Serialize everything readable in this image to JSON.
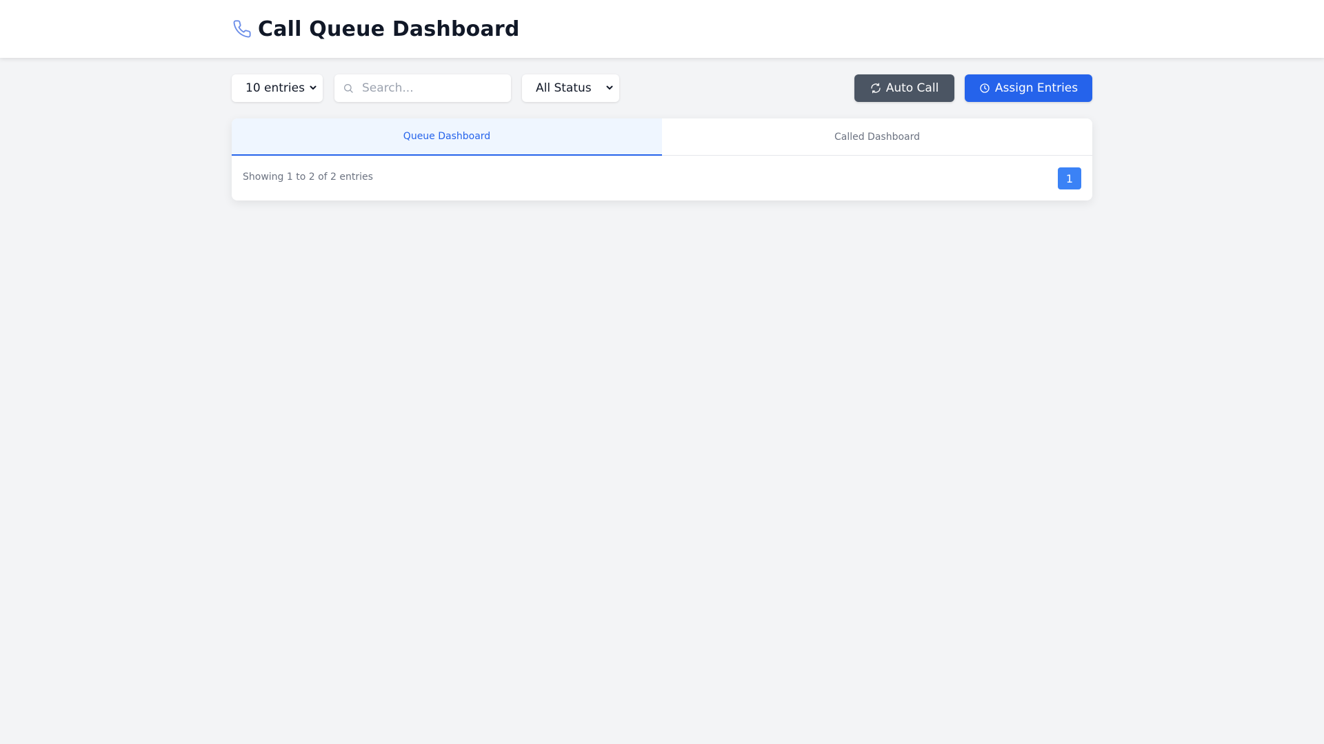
{
  "header": {
    "title": "Call Queue Dashboard",
    "icon": "phone-icon",
    "icon_color": "#6b8de8"
  },
  "toolbar": {
    "entries_select": {
      "selected": "10 entries"
    },
    "search": {
      "value": "",
      "placeholder": "Search..."
    },
    "status_select": {
      "selected": "All Status"
    },
    "auto_call_label": "Auto Call",
    "assign_label": "Assign Entries"
  },
  "tabs": [
    {
      "label": "Queue Dashboard",
      "active": true
    },
    {
      "label": "Called Dashboard",
      "active": false
    }
  ],
  "pagination": {
    "summary": "Showing 1 to 2 of 2 entries",
    "current_page": "1"
  },
  "colors": {
    "primary": "#2563eb",
    "secondary": "#4b5563",
    "page_button": "#3b82f6"
  }
}
